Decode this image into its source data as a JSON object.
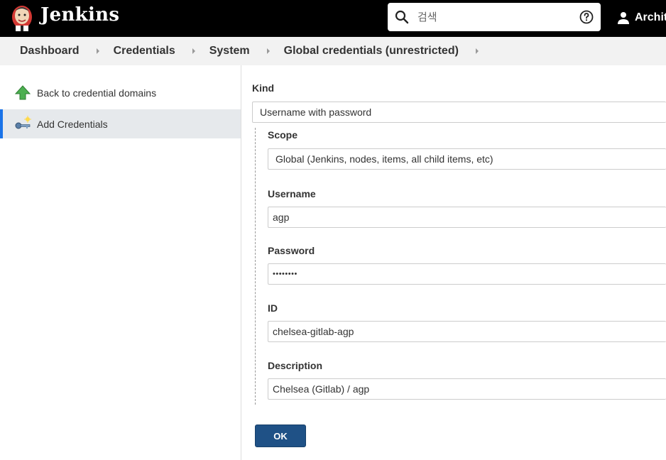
{
  "header": {
    "brand": "Jenkins",
    "search_placeholder": "검색",
    "user_name": "Archit",
    "colors": {
      "background": "#000000",
      "text": "#ffffff"
    }
  },
  "breadcrumb": [
    "Dashboard",
    "Credentials",
    "System",
    "Global credentials (unrestricted)"
  ],
  "sidebar": {
    "items": [
      {
        "label": "Back to credential domains",
        "icon": "up-arrow-icon",
        "active": false
      },
      {
        "label": "Add Credentials",
        "icon": "key-icon",
        "active": true
      }
    ]
  },
  "form": {
    "kind": {
      "label": "Kind",
      "value": "Username with password"
    },
    "scope": {
      "label": "Scope",
      "value": "Global (Jenkins, nodes, items, all child items, etc)"
    },
    "username": {
      "label": "Username",
      "value": "agp"
    },
    "password": {
      "label": "Password",
      "value": "••••••••"
    },
    "id": {
      "label": "ID",
      "value": "chelsea-gitlab-agp"
    },
    "description": {
      "label": "Description",
      "value": "Chelsea (Gitlab) / agp"
    },
    "ok_label": "OK"
  },
  "colors": {
    "accent": "#1f5186",
    "active_bar": "#1a73e8"
  }
}
